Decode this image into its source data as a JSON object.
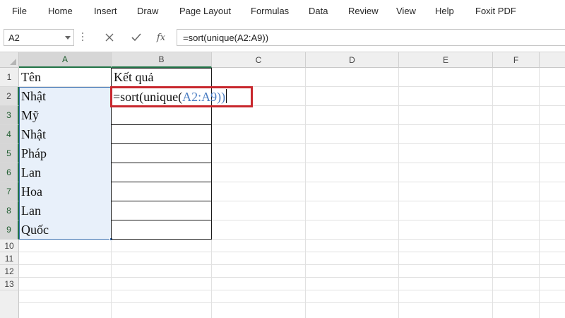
{
  "menu": {
    "items": [
      "File",
      "Home",
      "Insert",
      "Draw",
      "Page Layout",
      "Formulas",
      "Data",
      "Review",
      "View",
      "Help",
      "Foxit PDF"
    ]
  },
  "formula_bar": {
    "name_box": "A2",
    "formula": "=sort(unique(A2:A9))",
    "icons": [
      "cancel-x-icon",
      "confirm-check-icon",
      "insert-function-fx-icon"
    ]
  },
  "grid": {
    "columns": [
      "A",
      "B",
      "C",
      "D",
      "E",
      "F"
    ],
    "rows": [
      "1",
      "2",
      "3",
      "4",
      "5",
      "6",
      "7",
      "8",
      "9",
      "10",
      "11",
      "12",
      "13"
    ],
    "column_a": [
      "Tên",
      "Nhật",
      "Mỹ",
      "Nhật",
      "Pháp",
      "Lan",
      "Hoa",
      "Lan",
      "Quốc"
    ],
    "b1": "Kết quả",
    "editing_cell": {
      "prefix": "=sort(unique(",
      "ref": "A2:A9",
      "suffix": "))"
    }
  },
  "colors": {
    "selection_border": "#3a6fb0",
    "selection_fill": "#e8f0fa",
    "highlight_box": "#c8272d",
    "reference_text": "#4a7dc2",
    "excel_green": "#217346"
  }
}
